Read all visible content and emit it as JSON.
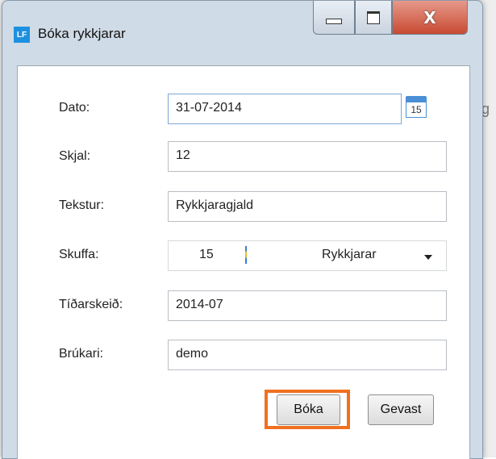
{
  "window": {
    "app_icon": "LF",
    "title": "Bóka rykkjarar",
    "controls": [
      "minimize-icon",
      "maximize-icon",
      "close-icon"
    ],
    "close_label": "X"
  },
  "form": {
    "date": {
      "label": "Dato:",
      "value": "31-07-2014",
      "calendar_day": "15"
    },
    "document": {
      "label": "Skjal:",
      "value": "12"
    },
    "text": {
      "label": "Tekstur:",
      "value": "Rykkjaragjald"
    },
    "drawer": {
      "label": "Skuffa:",
      "number": "15",
      "name": "Rykkjarar"
    },
    "period": {
      "label": "Tíðarskeið:",
      "value": "2014-07"
    },
    "user": {
      "label": "Brúkari:",
      "value": "demo"
    }
  },
  "buttons": {
    "ok": "Bóka",
    "cancel": "Gevast"
  },
  "background": {
    "edge_char": "g"
  },
  "colors": {
    "highlight": "#f07020",
    "accent": "#1e90e0"
  }
}
